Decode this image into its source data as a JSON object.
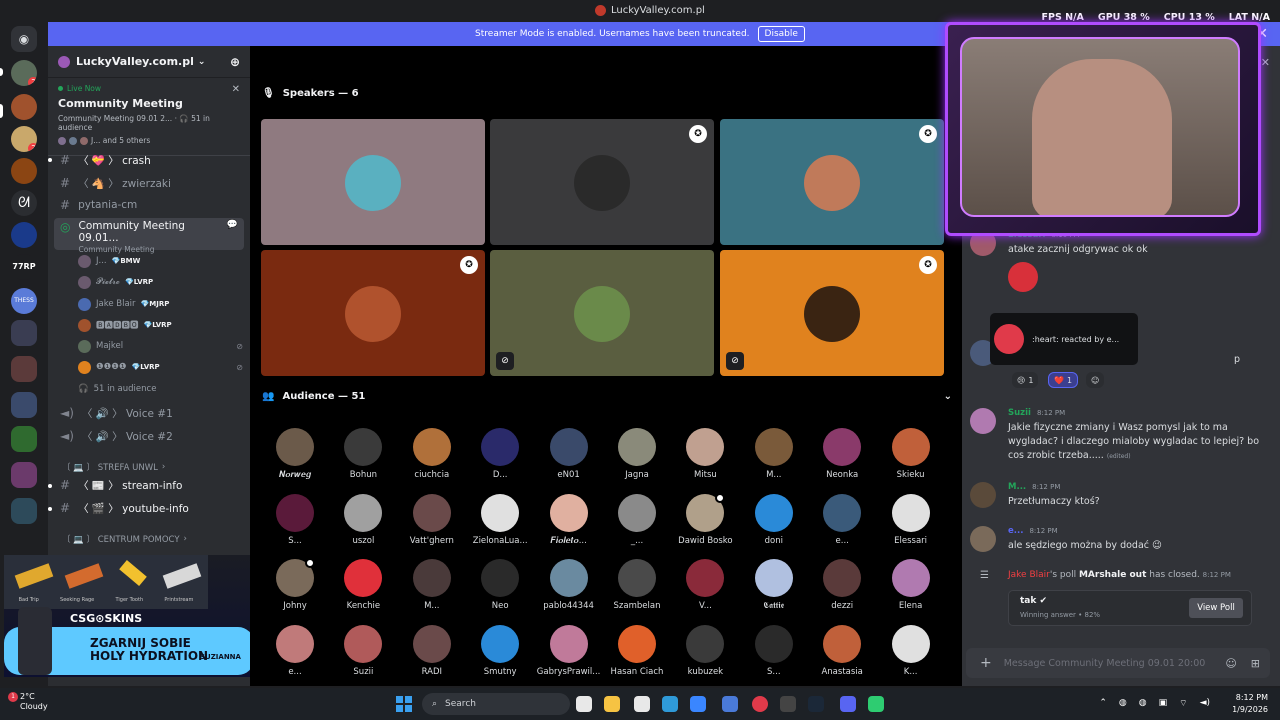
{
  "titlebar": {
    "title": "LuckyValley.com.pl"
  },
  "overlay": {
    "fps_label": "FPS",
    "fps": "N/A",
    "gpu_label": "GPU",
    "gpu": "38 %",
    "cpu_label": "CPU",
    "cpu": "13 %",
    "lat_label": "LAT",
    "lat": "N/A"
  },
  "banner": {
    "text": "Streamer Mode is enabled. Usernames have been truncated.",
    "button": "Disable"
  },
  "server": {
    "name": "LuckyValley.com.pl"
  },
  "servers": {
    "badges": [
      "2",
      "2"
    ]
  },
  "live": {
    "label": "Live Now",
    "title": "Community Meeting",
    "sub": "Community Meeting 09.01 2...",
    "audience": "51 in audience",
    "others": "J... and 5 others"
  },
  "channels": [
    {
      "prefix": "#",
      "label": "〈 💝 〉 crash",
      "bright": true
    },
    {
      "prefix": "#",
      "label": "〈 🐴 〉 zwierzaki",
      "bright": false
    },
    {
      "prefix": "#",
      "label": "pytania-cm",
      "bright": false
    }
  ],
  "stage_channel": {
    "name": "Community Meeting 09.01...",
    "topic": "Community Meeting"
  },
  "stage_users": [
    {
      "name": "J...",
      "tag": "💎BMW"
    },
    {
      "name": "𝓟𝓲𝓮𝓽𝓻𝓸",
      "tag": "💎LVRP"
    },
    {
      "name": "Jake Blair",
      "tag": "💎MJRP"
    },
    {
      "name": "🅱🅰🅳🅱🅾",
      "tag": "💎LVRP"
    },
    {
      "name": "Majkel",
      "tag": ""
    },
    {
      "name": "❶❶❶❶",
      "tag": "💎LVRP"
    }
  ],
  "stage_audience": "51 in audience",
  "voice": [
    {
      "label": "〈 🔊 〉 Voice #1"
    },
    {
      "label": "〈 🔊 〉 Voice #2"
    }
  ],
  "categories": {
    "strefa": "〔 💻 〕 STREFA UNWL",
    "centrum": "〔 💻 〕 CENTRUM POMOCY"
  },
  "text2": [
    {
      "label": "〈 📰 〉 stream-info"
    },
    {
      "label": "〈 🎬 〉 youtube-info"
    }
  ],
  "speakers": {
    "title": "Speakers — 6"
  },
  "audience": {
    "title": "Audience — 51",
    "members": [
      "𝑵𝒐𝒓𝒘𝒆𝒈",
      "Bohun",
      "ciuchcia",
      "D...",
      "eN01",
      "Jagna",
      "Mitsu",
      "M...",
      "Neonka",
      "Skieku",
      "S...",
      "uszol",
      "Vatt'ghern",
      "ZielonaLua...",
      "𝑭𝒊𝒐𝒍𝒆𝒕𝒐...",
      "_...",
      "Dawid Bosko",
      "doni",
      "e...",
      "Elessari",
      "Johny",
      "Kenchie",
      "M...",
      "Neo",
      "pablo44344",
      "Szambelan",
      "V...",
      "𝕮𝖆𝖙𝖙𝖎𝖊",
      "dezzi",
      "Elena",
      "e...",
      "Suzii",
      "RADI",
      "Smutny",
      "GabrysPrawil...",
      "Hasan Ciach",
      "kubuzek",
      "S...",
      "Anastasia",
      "K..."
    ]
  },
  "chat": {
    "messages": [
      {
        "name": "Elessari",
        "time": "8:10 PM",
        "text": "atake zacznij odgrywac ok ok"
      },
      {
        "name": "Suzii",
        "time": "8:12 PM",
        "text": "Jakie fizyczne zmiany i Wasz pomysl jak to ma wygladac? i dlaczego mialoby wygladac to lepiej? bo cos zrobic trzeba.....",
        "edited": "(edited)"
      },
      {
        "name": "M...",
        "time": "8:12 PM",
        "text": "Przetłumaczy ktoś?"
      },
      {
        "name": "e...",
        "time": "8:12 PM",
        "text": "ale sędziego można by dodać 😉"
      }
    ],
    "reactions": [
      {
        "emoji": "😢",
        "count": "1"
      },
      {
        "emoji": "❤️",
        "count": "1"
      }
    ],
    "tooltip": ":heart: reacted by e...",
    "partial": "p",
    "poll_system": {
      "who": "Jake Blair",
      "pre": "'s poll ",
      "poll": "MArshale out",
      "post": " has closed.",
      "time": "8:12 PM"
    },
    "poll": {
      "answer": "tak ✔",
      "winning": "Winning answer • 82%",
      "view": "View Poll"
    },
    "input_placeholder": "Message Community Meeting 09.01 20:00"
  },
  "ad": {
    "brand": "CSG⊙SKINS",
    "line1": "ZGARNIJ SOBIE",
    "line2": "HOLY HYDRATION",
    "tag": "SUZIANNA",
    "skins": [
      "Bad Trip",
      "Seeking Rage",
      "Tiger Tooth",
      "Printstream"
    ]
  },
  "taskbar": {
    "temp": "2°C",
    "weather": "Cloudy",
    "search": "Search",
    "time": "8:12 PM",
    "date": "1/9/2026",
    "notif": "1"
  }
}
